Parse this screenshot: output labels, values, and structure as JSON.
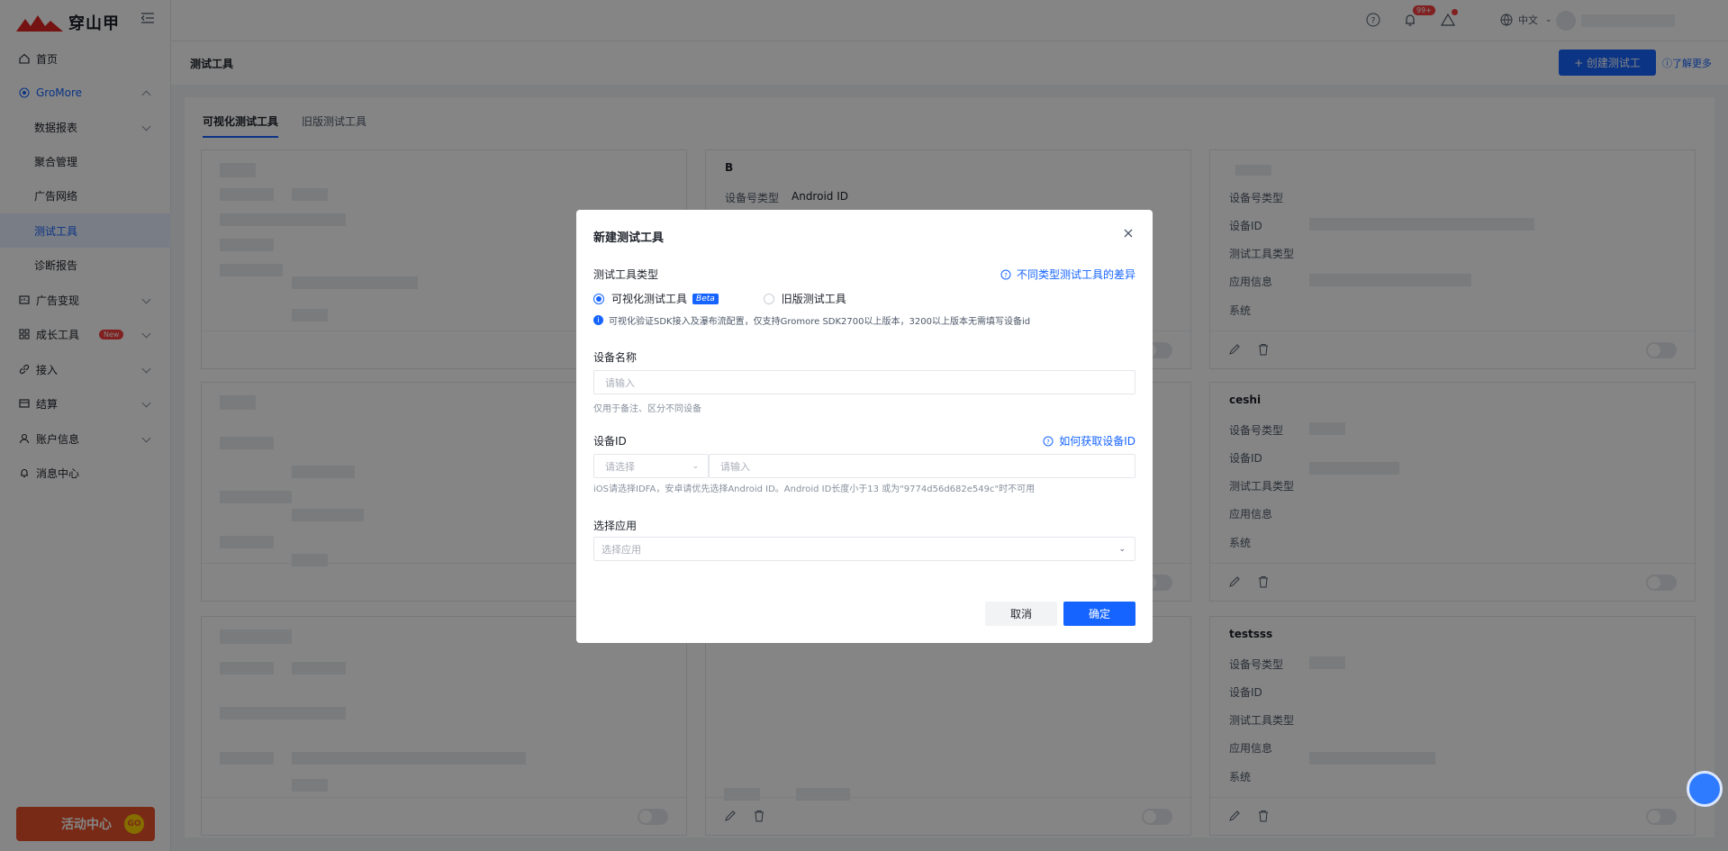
{
  "sidebar": {
    "logo_text": "穿山甲",
    "items": [
      {
        "label": "首页",
        "icon": "home-icon"
      },
      {
        "label": "GroMore",
        "icon": "gromore-icon"
      },
      {
        "label": "数据报表"
      },
      {
        "label": "聚合管理"
      },
      {
        "label": "广告网络"
      },
      {
        "label": "测试工具"
      },
      {
        "label": "诊断报告"
      },
      {
        "label": "广告变现",
        "icon": "monetize-icon"
      },
      {
        "label": "成长工具",
        "icon": "grid-icon",
        "badge": "New"
      },
      {
        "label": "接入",
        "icon": "link-icon"
      },
      {
        "label": "结算",
        "icon": "wallet-icon"
      },
      {
        "label": "账户信息",
        "icon": "user-icon"
      },
      {
        "label": "消息中心",
        "icon": "bell-icon"
      }
    ],
    "promo_label": "活动中心",
    "promo_go": "GO"
  },
  "header": {
    "notif_count": "99+",
    "lang": "中文"
  },
  "page": {
    "title": "测试工具",
    "create_button": "+ 创建测试工",
    "learn_more": "了解更多",
    "tabs": [
      "可视化测试工具",
      "旧版测试工具"
    ]
  },
  "cards": {
    "b_title": "B",
    "b_device_type_label": "设备号类型",
    "b_device_type_value": "Android ID",
    "right_labels": [
      "设备号类型",
      "设备ID",
      "测试工具类型",
      "应用信息",
      "系统"
    ],
    "ceshi_title": "ceshi",
    "testsss_title": "testsss"
  },
  "modal": {
    "title": "新建测试工具",
    "type_label": "测试工具类型",
    "type_diff_link": "不同类型测试工具的差异",
    "radio_visual": "可视化测试工具",
    "beta": "Beta",
    "radio_legacy": "旧版测试工具",
    "info_text": "可视化验证SDK接入及瀑布流配置，仅支持Gromore SDK2700以上版本，3200以上版本无需填写设备id",
    "name_label": "设备名称",
    "name_placeholder": "请输入",
    "name_hint": "仅用于备注、区分不同设备",
    "device_id_label": "设备ID",
    "how_to_get_link": "如何获取设备ID",
    "device_select_placeholder": "请选择",
    "device_input_placeholder": "请输入",
    "device_hint": "iOS请选择IDFA，安卓请优先选择Android ID。Android ID长度小于13 或为\"9774d56d682e549c\"时不可用",
    "app_label": "选择应用",
    "app_placeholder": "选择应用",
    "cancel": "取消",
    "confirm": "确定"
  }
}
